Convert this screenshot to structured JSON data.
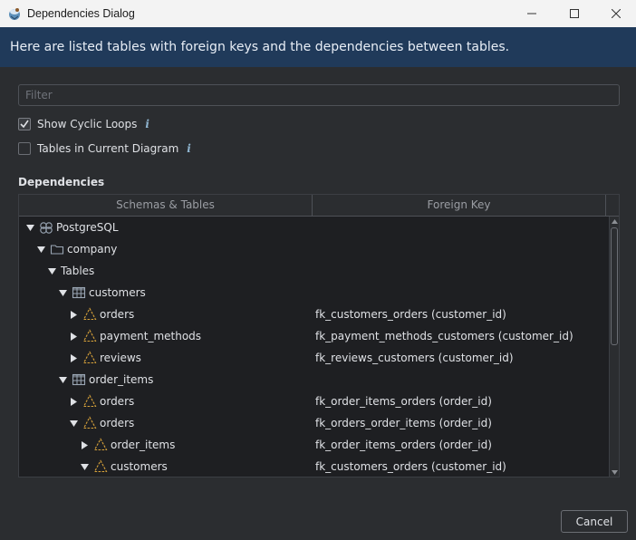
{
  "window": {
    "title": "Dependencies Dialog",
    "app_icon": "dbeaver-app-icon"
  },
  "banner": {
    "text": "Here are listed tables with foreign keys and the dependencies between tables."
  },
  "filter": {
    "placeholder": "Filter",
    "value": ""
  },
  "options": {
    "show_cyclic_loops": {
      "label": "Show Cyclic Loops",
      "checked": true
    },
    "tables_in_current_diagram": {
      "label": "Tables in Current Diagram",
      "checked": false
    }
  },
  "dependencies": {
    "label": "Dependencies",
    "columns": [
      "Schemas & Tables",
      "Foreign Key"
    ],
    "rows": [
      {
        "depth": 0,
        "expand": "expanded",
        "icon": "database-icon",
        "name": "PostgreSQL",
        "fk": ""
      },
      {
        "depth": 1,
        "expand": "expanded",
        "icon": "schema-folder-icon",
        "name": "company",
        "fk": ""
      },
      {
        "depth": 2,
        "expand": "expanded",
        "icon": "none",
        "name": "Tables",
        "fk": ""
      },
      {
        "depth": 3,
        "expand": "expanded",
        "icon": "table-icon",
        "name": "customers",
        "fk": ""
      },
      {
        "depth": 4,
        "expand": "collapsed",
        "icon": "foreign-key-icon",
        "name": "orders",
        "fk": "fk_customers_orders (customer_id)"
      },
      {
        "depth": 4,
        "expand": "collapsed",
        "icon": "foreign-key-icon",
        "name": "payment_methods",
        "fk": "fk_payment_methods_customers (customer_id)"
      },
      {
        "depth": 4,
        "expand": "collapsed",
        "icon": "foreign-key-icon",
        "name": "reviews",
        "fk": "fk_reviews_customers (customer_id)"
      },
      {
        "depth": 3,
        "expand": "expanded",
        "icon": "table-icon",
        "name": "order_items",
        "fk": ""
      },
      {
        "depth": 4,
        "expand": "collapsed",
        "icon": "foreign-key-icon",
        "name": "orders",
        "fk": "fk_order_items_orders (order_id)"
      },
      {
        "depth": 4,
        "expand": "expanded",
        "icon": "foreign-key-icon",
        "name": "orders",
        "fk": "fk_orders_order_items (order_id)"
      },
      {
        "depth": 5,
        "expand": "collapsed",
        "icon": "foreign-key-icon",
        "name": "order_items",
        "fk": "fk_order_items_orders (order_id)"
      },
      {
        "depth": 5,
        "expand": "expanded",
        "icon": "foreign-key-icon",
        "name": "customers",
        "fk": "fk_customers_orders (customer_id)"
      }
    ]
  },
  "buttons": {
    "cancel": "Cancel"
  },
  "colors": {
    "banner_bg": "#203a5a",
    "dialog_bg": "#2b2d30",
    "table_bg": "#1e1f22",
    "fk_icon": "#d6a13a",
    "table_icon": "#9aa6b4"
  }
}
